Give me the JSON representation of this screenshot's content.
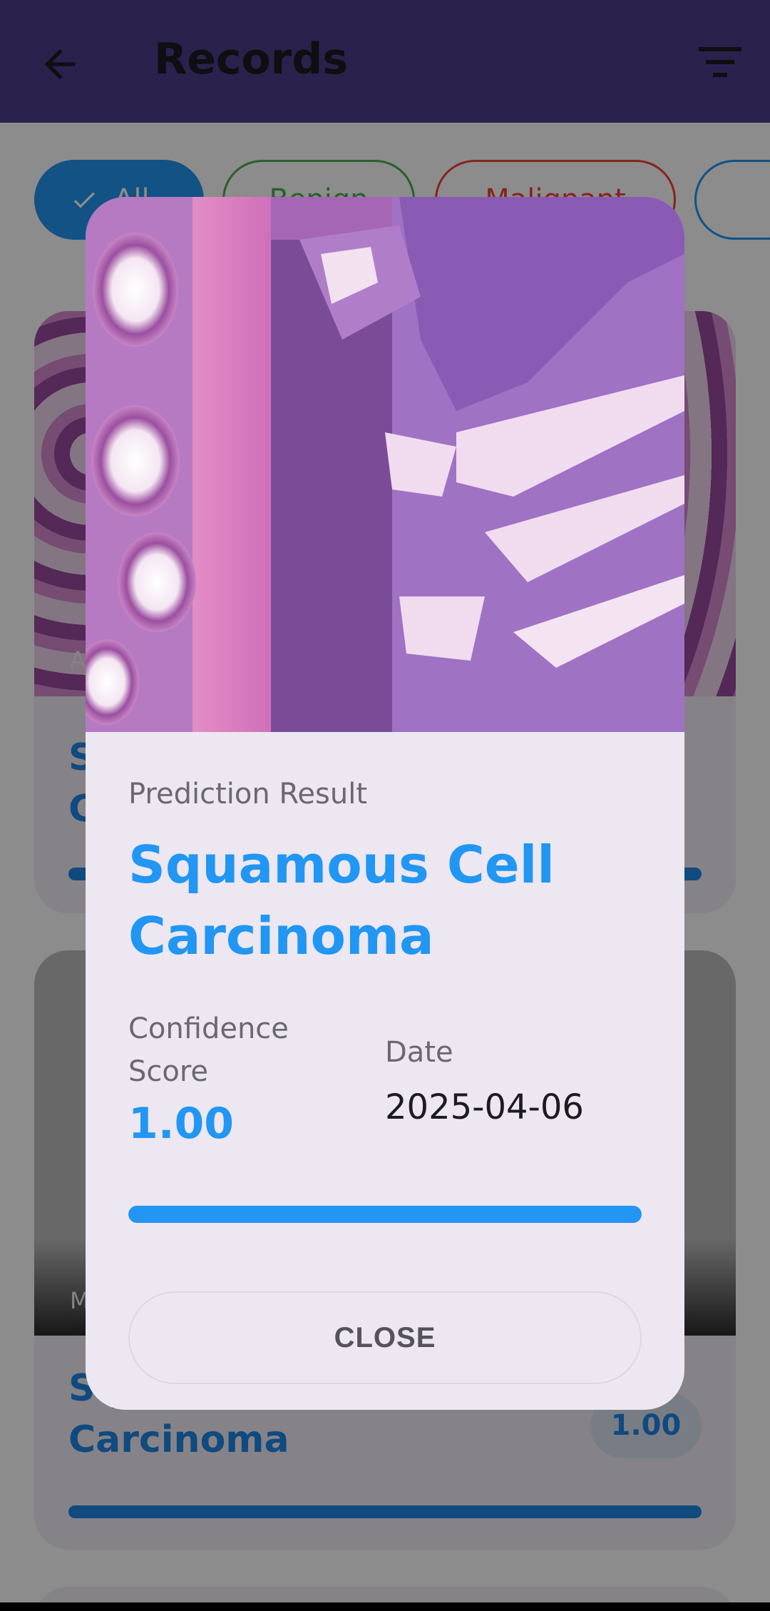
{
  "app_bar": {
    "title": "Records",
    "back_icon": "arrow-back-icon",
    "filter_icon": "filter-icon",
    "background_color": "#4f3c8c"
  },
  "filter_chips": [
    {
      "label": "All",
      "selected": true,
      "color": "#2196f3"
    },
    {
      "label": "Benign",
      "selected": false,
      "color": "#4caf50"
    },
    {
      "label": "Malignant",
      "selected": false,
      "color": "#f44336"
    }
  ],
  "records": [
    {
      "tag": "A",
      "name_line1": "S",
      "name_line2": "C"
    },
    {
      "tag": "M",
      "name_line1": "Sq",
      "name_line2": "Carcinoma",
      "score": "1.00"
    }
  ],
  "dialog": {
    "label": "Prediction Result",
    "prediction": "Squamous Cell Carcinoma",
    "confidence_label": "Confidence Score",
    "confidence_value": "1.00",
    "confidence_fraction": 1.0,
    "date_label": "Date",
    "date_value": "2025-04-06",
    "close_label": "CLOSE",
    "accent_color": "#2196f3"
  }
}
